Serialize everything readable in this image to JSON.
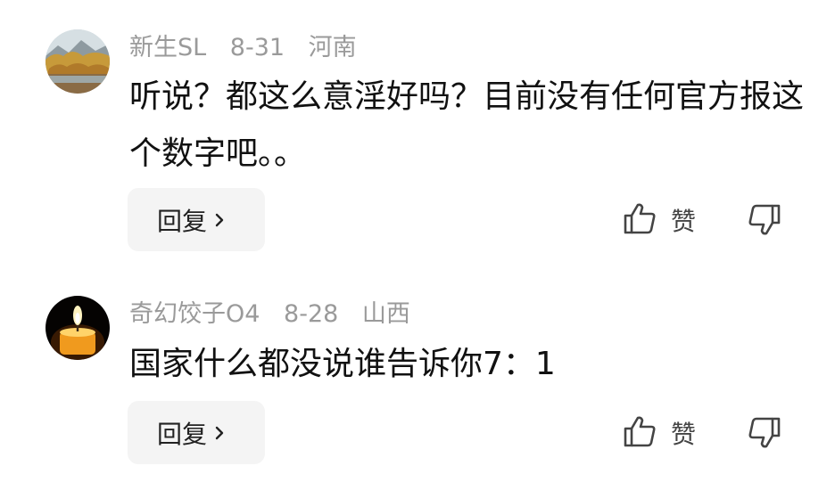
{
  "comments": [
    {
      "username": "新生SL",
      "date": "8-31",
      "location": "河南",
      "text": "听说？都这么意淫好吗？目前没有任何官方报这个数字吧。。",
      "reply_label": "回复",
      "like_label": "赞"
    },
    {
      "username": "奇幻饺子O4",
      "date": "8-28",
      "location": "山西",
      "text": "国家什么都没说谁告诉你7：1",
      "reply_label": "回复",
      "like_label": "赞"
    }
  ],
  "icons": {
    "reply_chevron": "chevron-right-icon",
    "like": "thumbs-up-icon",
    "dislike": "thumbs-down-icon"
  },
  "colors": {
    "meta_text": "#9a9a9a",
    "body_text": "#111111",
    "reply_button_bg": "#f4f4f4"
  }
}
